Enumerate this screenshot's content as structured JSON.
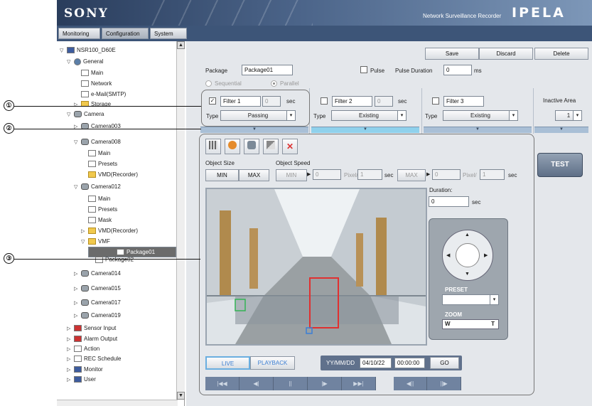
{
  "header": {
    "brand": "SONY",
    "product": "Network Surveillance Recorder",
    "ipela": "IPELA"
  },
  "top_tabs": [
    "Monitoring",
    "Configuration",
    "System"
  ],
  "tree": {
    "root": "NSR100_D60E",
    "general": "General",
    "main": "Main",
    "network": "Network",
    "email": "e-Mail(SMTP)",
    "storage": "Storage",
    "camera": "Camera",
    "camera003": "Camera003",
    "camera008": "Camera008",
    "c008_main": "Main",
    "c008_presets": "Presets",
    "c008_vmd": "VMD(Recorder)",
    "camera012": "Camera012",
    "c012_main": "Main",
    "c012_presets": "Presets",
    "c012_mask": "Mask",
    "c012_vmd": "VMD(Recorder)",
    "vmf": "VMF",
    "package01": "Package01",
    "package02": "Package02",
    "camera014": "Camera014",
    "camera015": "Camera015",
    "camera017": "Camera017",
    "camera019": "Camera019",
    "sensor": "Sensor Input",
    "alarm": "Alarm Output",
    "action": "Action",
    "rec": "REC Schedule",
    "monitor": "Monitor",
    "user": "User"
  },
  "actions": {
    "save": "Save",
    "discard": "Discard",
    "delete": "Delete"
  },
  "package": {
    "label": "Package",
    "value": "Package01",
    "pulse": "Pulse",
    "pulse_duration": "Pulse Duration",
    "pulse_value": "0",
    "ms": "ms",
    "sequential": "Sequential",
    "parallel": "Parallel"
  },
  "filters": [
    {
      "name": "Filter 1",
      "time": "0",
      "sec": "sec",
      "type_label": "Type",
      "type": "Passing",
      "checked": "✓"
    },
    {
      "name": "Filter 2",
      "time": "0",
      "sec": "sec",
      "type_label": "Type",
      "type": "Existing",
      "checked": ""
    },
    {
      "name": "Filter 3",
      "sec": "",
      "type_label": "Type",
      "type": "Existing",
      "checked": ""
    }
  ],
  "inactive": {
    "label": "Inactive Area",
    "value": "1"
  },
  "test_label": "TEST",
  "object": {
    "size": "Object Size",
    "speed": "Object Speed",
    "min": "MIN",
    "max": "MAX",
    "smin": "MIN",
    "smax": "MAX",
    "v1": "0",
    "v2": "1",
    "v3": "0",
    "v4": "1",
    "pixel": "Pixel/",
    "sec": "sec"
  },
  "duration": {
    "label": "Duration:",
    "value": "0",
    "sec": "sec"
  },
  "ptz": {
    "preset": "PRESET",
    "zoom": "ZOOM",
    "w": "W",
    "t": "T"
  },
  "playback": {
    "live": "LIVE",
    "playback": "PLAYBACK",
    "date_fmt": "YY/MM/DD",
    "date": "04/10/22",
    "time": "00:00:00",
    "go": "GO"
  },
  "callouts": [
    "①",
    "②",
    "③"
  ]
}
